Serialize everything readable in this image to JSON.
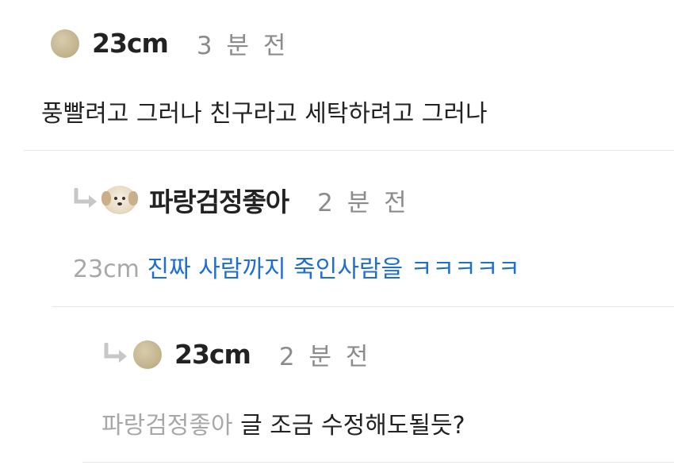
{
  "comments": [
    {
      "nickname": "23cm",
      "time": "3 분 전",
      "text": "풍빨려고 그러나 친구라고 세탁하려고 그러나"
    },
    {
      "nickname": "파랑검정좋아",
      "time": "2 분 전",
      "mention": "23cm",
      "text": "진짜 사람까지 죽인사람을 ㅋㅋㅋㅋㅋ"
    },
    {
      "nickname": "23cm",
      "time": "2 분 전",
      "mention": "파랑검정좋아",
      "text": "글 조금 수정해도될듯?"
    }
  ],
  "icons": {
    "reply": "reply-arrow-icon",
    "avatar_plain": "avatar-dot",
    "avatar_dog": "avatar-puppy"
  },
  "colors": {
    "reply_text_blue": "#1f6fd1",
    "mention_gray": "#a8a8a8",
    "time_gray": "#8c8c8c",
    "divider": "#e6e6e6",
    "reply_arrow": "#c7c7c7"
  }
}
